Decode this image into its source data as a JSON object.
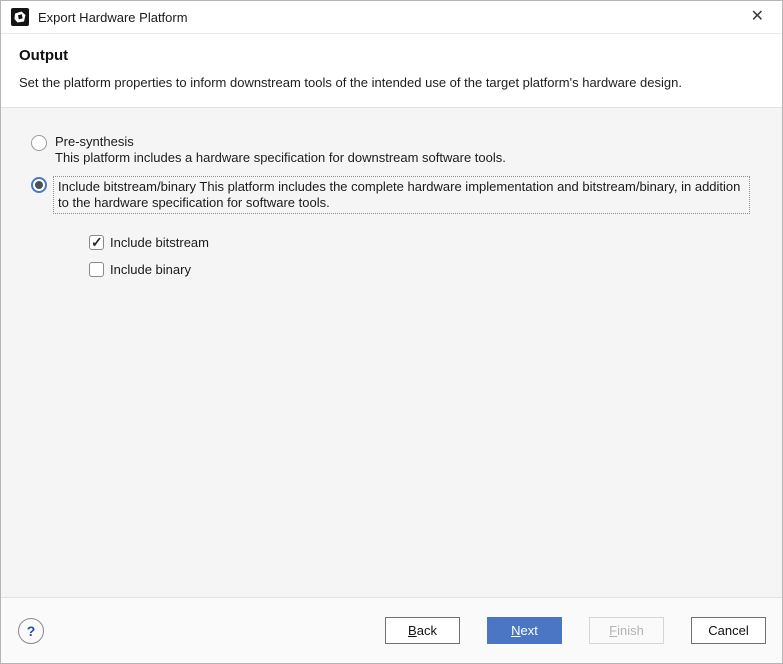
{
  "window": {
    "title": "Export Hardware Platform",
    "close_glyph": "✕"
  },
  "header": {
    "title": "Output",
    "description": "Set the platform properties to inform downstream tools of the intended use of the target platform's hardware design."
  },
  "options": {
    "pre_synthesis": {
      "label": "Pre-synthesis",
      "description": "This platform includes a hardware specification for downstream software tools.",
      "selected": false
    },
    "include_bitstream_binary": {
      "label": "Include bitstream/binary",
      "description": "This platform includes the complete hardware implementation and bitstream/binary, in addition to the hardware specification for software tools.",
      "selected": true
    },
    "checkboxes": [
      {
        "label": "Include bitstream",
        "checked": true
      },
      {
        "label": "Include binary",
        "checked": false
      }
    ]
  },
  "footer": {
    "help_glyph": "?",
    "buttons": {
      "back": {
        "mnemonic": "B",
        "rest": "ack"
      },
      "next": {
        "mnemonic": "N",
        "rest": "ext"
      },
      "finish": {
        "mnemonic": "F",
        "rest": "inish"
      },
      "cancel": {
        "label": "Cancel"
      }
    }
  },
  "colors": {
    "accent_blue": "#4a76c4",
    "content_bg": "#f5f5f5",
    "footer_bg": "#fafafa",
    "help_blue": "#27509b"
  }
}
